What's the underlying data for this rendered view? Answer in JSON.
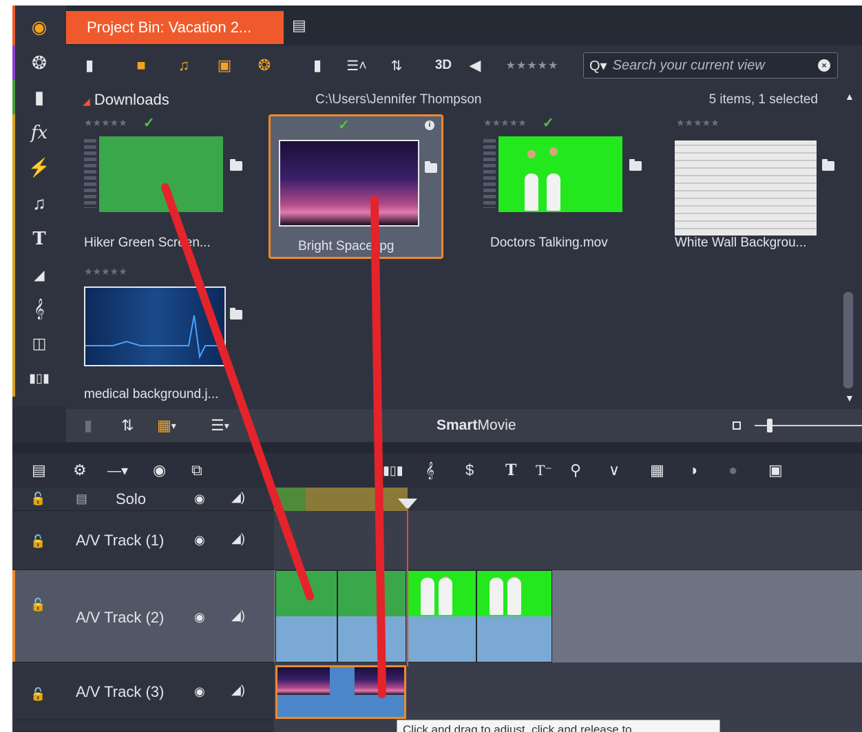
{
  "bin": {
    "tab_title": "Project Bin: Vacation 2...",
    "folder": "Downloads",
    "path": "C:\\Users\\Jennifer Thompson",
    "count": "5 items, 1 selected",
    "search_placeholder": "Search your current view",
    "toolbar_3d": "3D",
    "items": [
      {
        "name": "Hiker Green Screen...",
        "rating": "★★★★★",
        "checked": true
      },
      {
        "name": "Bright Space.jpg",
        "rating": "",
        "checked": true
      },
      {
        "name": "Doctors Talking.mov",
        "rating": "★★★★★",
        "checked": true
      },
      {
        "name": "White Wall Backgrou...",
        "rating": "★★★★★",
        "checked": false
      },
      {
        "name": "medical background.j...",
        "rating": "★★★★★",
        "checked": false
      }
    ]
  },
  "binbar": {
    "smart_bold": "Smart",
    "smart_rest": "Movie"
  },
  "timeline": {
    "tracks": [
      {
        "name": "Solo"
      },
      {
        "name": "A/V Track (1)"
      },
      {
        "name": "A/V Track (2)"
      },
      {
        "name": "A/V Track (3)"
      }
    ],
    "tooltip": "Click and drag to adjust, click and release to"
  },
  "colors": {
    "accent": "#f0592b",
    "selection": "#ef8a2a",
    "annotation": "#e5232b"
  }
}
